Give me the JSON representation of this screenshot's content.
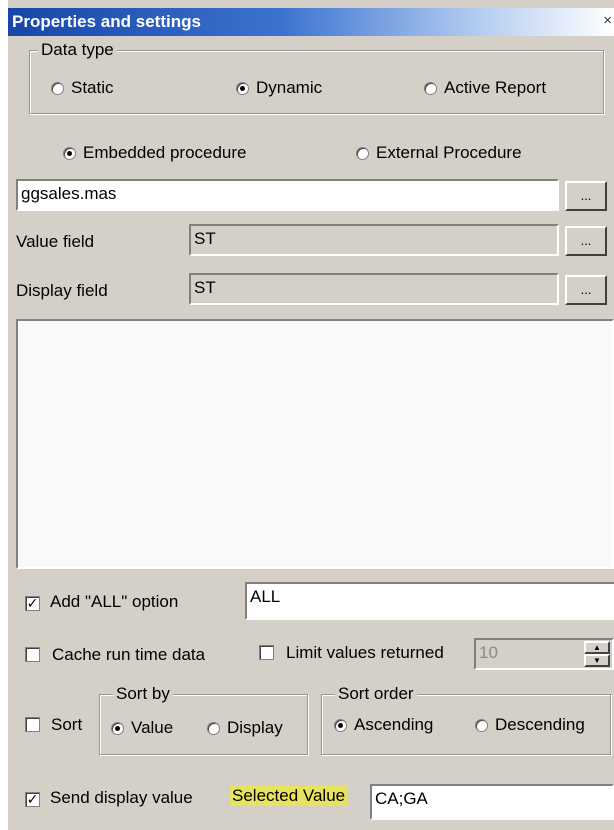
{
  "window": {
    "title": "Properties and settings",
    "close_label": "×"
  },
  "data_type": {
    "legend": "Data type",
    "options": [
      {
        "label": "Static",
        "checked": false
      },
      {
        "label": "Dynamic",
        "checked": true
      },
      {
        "label": "Active Report",
        "checked": false
      }
    ]
  },
  "procedure": {
    "options": [
      {
        "label": "Embedded procedure",
        "checked": true
      },
      {
        "label": "External Procedure",
        "checked": false
      }
    ],
    "file_value": "ggsales.mas",
    "browse_label": "..."
  },
  "value_field": {
    "label": "Value field",
    "value": "ST",
    "browse_label": "..."
  },
  "display_field": {
    "label": "Display field",
    "value": "ST",
    "browse_label": "..."
  },
  "add_all": {
    "label": "Add \"ALL\" option",
    "checked": true,
    "value": "ALL"
  },
  "cache": {
    "label": "Cache run time data",
    "checked": false
  },
  "limit": {
    "label": "Limit values returned",
    "checked": false,
    "value": "10"
  },
  "sort": {
    "label": "Sort",
    "checked": false
  },
  "sort_by": {
    "legend": "Sort by",
    "options": [
      {
        "label": "Value",
        "checked": true
      },
      {
        "label": "Display",
        "checked": false
      }
    ]
  },
  "sort_order": {
    "legend": "Sort order",
    "options": [
      {
        "label": "Ascending",
        "checked": true
      },
      {
        "label": "Descending",
        "checked": false
      }
    ]
  },
  "send_display": {
    "label": "Send display value",
    "checked": true
  },
  "selected_value": {
    "label": "Selected Value",
    "value": "CA;GA"
  },
  "colors": {
    "title_bar": "#1846a8",
    "panel": "#d4d0c8",
    "highlight": "#e7e35f"
  }
}
